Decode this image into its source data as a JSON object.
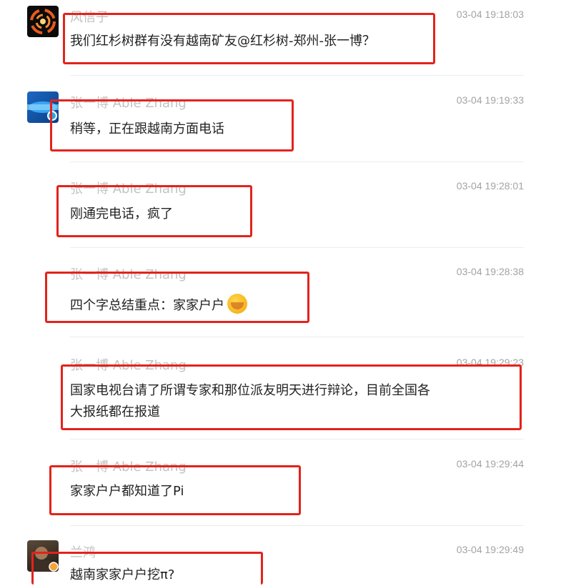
{
  "messages": [
    {
      "sender": "风信子",
      "time": "03-04 19:18:03",
      "text": "我们红杉树群有没有越南矿友@红杉树-郑州-张一博？"
    },
    {
      "sender": "张一博 Able Zhang",
      "time": "03-04 19:19:33",
      "text": "稍等，正在跟越南方面电话"
    },
    {
      "sender": "张一博 Able Zhang",
      "time": "03-04 19:28:01",
      "text": "刚通完电话，疯了"
    },
    {
      "sender": "张一博 Able Zhang",
      "time": "03-04 19:28:38",
      "text": "四个字总结重点：家家户户"
    },
    {
      "sender": "张一博 Able Zhang",
      "time": "03-04 19:29:23",
      "text_line1": "国家电视台请了所谓专家和那位派友明天进行辩论，目前全国各",
      "text_line2": "大报纸都在报道"
    },
    {
      "sender": "张一博 Able Zhang",
      "time": "03-04 19:29:44",
      "text": "家家户户都知道了Pi"
    },
    {
      "sender": "兰鸿",
      "time": "03-04 19:29:49",
      "text": "越南家家户户挖π?"
    }
  ],
  "icons": {
    "avatar_1": "galaxy-avatar-icon",
    "avatar_2": "blue-logo-avatar-icon",
    "avatar_3": "photo-avatar-icon",
    "emoji": "hand-over-mouth-emoji-icon"
  },
  "colors": {
    "highlight": "#e3231b",
    "sender": "#c2c2c2",
    "time": "#a3a3a3",
    "text": "#222222"
  }
}
